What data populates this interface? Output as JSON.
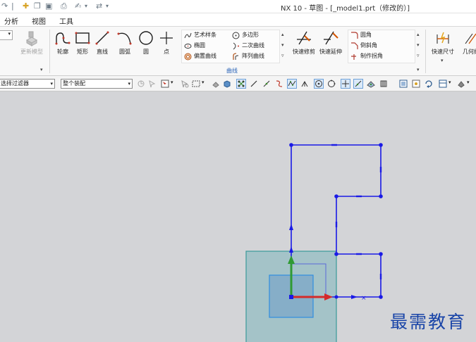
{
  "window": {
    "title": "NX 10 - 草图 - [_model1.prt（修改的）]"
  },
  "menu": {
    "items": [
      "分析",
      "视图",
      "工具"
    ]
  },
  "ribbon": {
    "feature_group": {
      "update_model": "更新模型"
    },
    "curve_group": {
      "label": "曲线",
      "big_buttons": [
        "轮廓",
        "矩形",
        "直线",
        "圆弧",
        "圆",
        "点"
      ],
      "small_buttons_col1": [
        "艺术样条",
        "椭圆",
        "偏置曲线"
      ],
      "small_buttons_col2": [
        "多边形",
        "二次曲线",
        "阵列曲线"
      ],
      "edit_buttons": [
        "快速修剪",
        "快速延伸"
      ],
      "corner_buttons": [
        "圆角",
        "倒斜角",
        "制作拐角"
      ]
    },
    "dimension_group": {
      "quick_dim": "快速尺寸",
      "geometric": "几何约"
    }
  },
  "selection_bar": {
    "filter": "选择过滤器",
    "scope": "整个装配"
  },
  "watermark": "最需教育",
  "colors": {
    "sketch_curve": "#1a1ae6",
    "datum_plane_fill": "#9ec1c7",
    "datum_plane_edge": "#3a9a9a",
    "x_axis": "#d42a2a",
    "y_axis": "#2f9a33",
    "ribbon_group_label": "#2d66b8"
  }
}
